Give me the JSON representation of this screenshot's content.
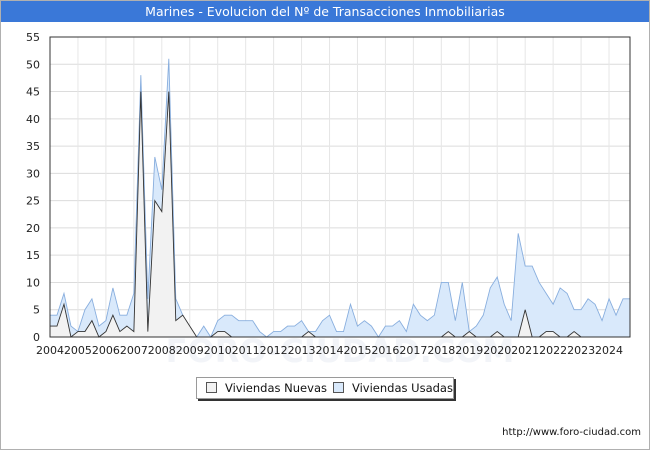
{
  "title": "Marines - Evolucion del Nº de Transacciones Inmobiliarias",
  "source": "http://www.foro-ciudad.com",
  "watermark": "FORO-CIUDAD.COM",
  "legend": [
    {
      "label": "Viviendas Nuevas",
      "color": "#f2f2f2"
    },
    {
      "label": "Viviendas Usadas",
      "color": "#d9e9fb"
    }
  ],
  "chart_data": {
    "type": "area",
    "title": "Marines - Evolucion del Nº de Transacciones Inmobiliarias",
    "xlabel": "",
    "ylabel": "",
    "ylim": [
      0,
      55
    ],
    "yticks": [
      0,
      5,
      10,
      15,
      20,
      25,
      30,
      35,
      40,
      45,
      50,
      55
    ],
    "xlim": [
      "2004T1",
      "2024T4"
    ],
    "x_tick_labels": [
      "2004",
      "2005",
      "2006",
      "2007",
      "2008",
      "2009",
      "2010",
      "2011",
      "2012",
      "2013",
      "2014",
      "2015",
      "2016",
      "2017",
      "2018",
      "2019",
      "2020",
      "2021",
      "2022",
      "2023",
      "2024"
    ],
    "grid": true,
    "legend_position": "bottom",
    "x": [
      "2004T1",
      "2004T2",
      "2004T3",
      "2004T4",
      "2005T1",
      "2005T2",
      "2005T3",
      "2005T4",
      "2006T1",
      "2006T2",
      "2006T3",
      "2006T4",
      "2007T1",
      "2007T2",
      "2007T3",
      "2007T4",
      "2008T1",
      "2008T2",
      "2008T3",
      "2008T4",
      "2009T1",
      "2009T2",
      "2009T3",
      "2009T4",
      "2010T1",
      "2010T2",
      "2010T3",
      "2010T4",
      "2011T1",
      "2011T2",
      "2011T3",
      "2011T4",
      "2012T1",
      "2012T2",
      "2012T3",
      "2012T4",
      "2013T1",
      "2013T2",
      "2013T3",
      "2013T4",
      "2014T1",
      "2014T2",
      "2014T3",
      "2014T4",
      "2015T1",
      "2015T2",
      "2015T3",
      "2015T4",
      "2016T1",
      "2016T2",
      "2016T3",
      "2016T4",
      "2017T1",
      "2017T2",
      "2017T3",
      "2017T4",
      "2018T1",
      "2018T2",
      "2018T3",
      "2018T4",
      "2019T1",
      "2019T2",
      "2019T3",
      "2019T4",
      "2020T1",
      "2020T2",
      "2020T3",
      "2020T4",
      "2021T1",
      "2021T2",
      "2021T3",
      "2021T4",
      "2022T1",
      "2022T2",
      "2022T3",
      "2022T4",
      "2023T1",
      "2023T2",
      "2023T3",
      "2023T4",
      "2024T1",
      "2024T2",
      "2024T3",
      "2024T4"
    ],
    "series": [
      {
        "name": "Viviendas Nuevas",
        "color": "#f2f2f2",
        "line_color": "#333333",
        "values": [
          2,
          2,
          6,
          0,
          1,
          1,
          3,
          0,
          1,
          4,
          1,
          2,
          1,
          45,
          1,
          25,
          23,
          45,
          3,
          4,
          2,
          0,
          0,
          0,
          1,
          1,
          0,
          0,
          0,
          0,
          0,
          0,
          0,
          0,
          0,
          0,
          0,
          1,
          0,
          0,
          0,
          0,
          0,
          0,
          0,
          0,
          0,
          0,
          0,
          0,
          0,
          0,
          0,
          0,
          0,
          0,
          0,
          1,
          0,
          0,
          1,
          0,
          0,
          0,
          1,
          0,
          0,
          0,
          5,
          0,
          0,
          1,
          1,
          0,
          0,
          1,
          0,
          0,
          0,
          0,
          0,
          0,
          0,
          0
        ]
      },
      {
        "name": "Viviendas Usadas",
        "color": "#d9e9fb",
        "line_color": "#88aede",
        "values": [
          4,
          4,
          8,
          2,
          1,
          5,
          7,
          2,
          3,
          9,
          4,
          4,
          8,
          48,
          7,
          33,
          27,
          51,
          7,
          4,
          1,
          0,
          2,
          0,
          3,
          4,
          4,
          3,
          3,
          3,
          1,
          0,
          1,
          1,
          2,
          2,
          3,
          1,
          1,
          3,
          4,
          1,
          1,
          6,
          2,
          3,
          2,
          0,
          2,
          2,
          3,
          1,
          6,
          4,
          3,
          4,
          10,
          10,
          3,
          10,
          1,
          2,
          4,
          9,
          11,
          6,
          3,
          19,
          13,
          13,
          10,
          8,
          6,
          9,
          8,
          5,
          5,
          7,
          6,
          3,
          7,
          4,
          7,
          7
        ]
      }
    ]
  }
}
